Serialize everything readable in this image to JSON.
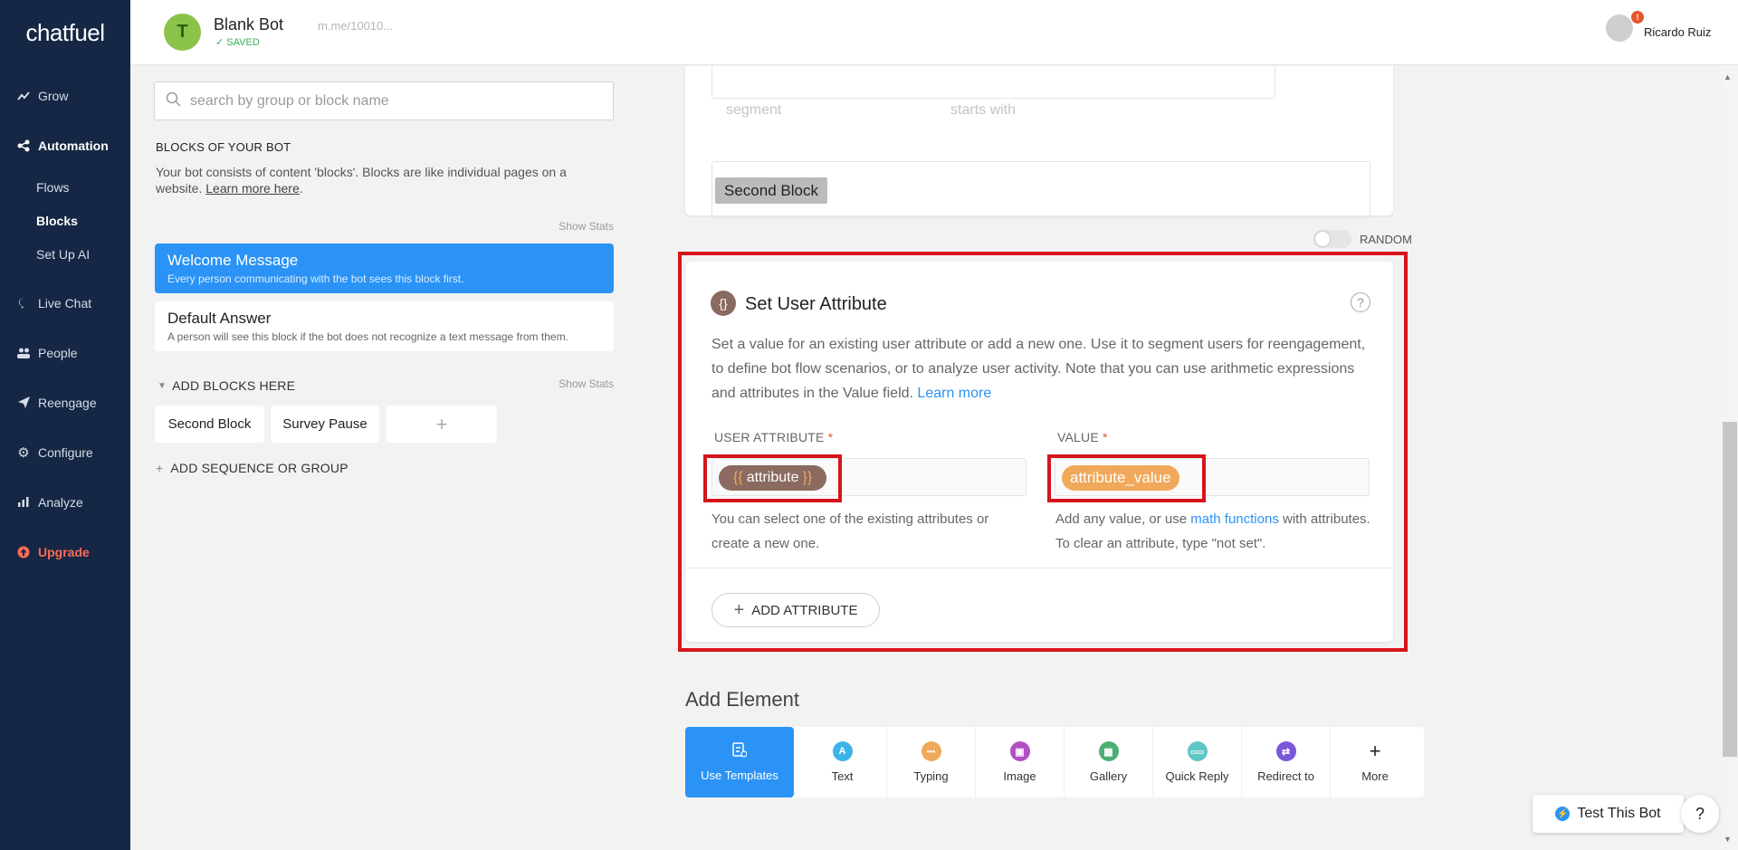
{
  "nav": {
    "logo": "chatfuel",
    "items": [
      {
        "label": "Grow",
        "icon": "trend-icon"
      },
      {
        "label": "Automation",
        "icon": "flow-icon"
      },
      {
        "label": "Live Chat",
        "icon": "chat-icon"
      },
      {
        "label": "People",
        "icon": "people-icon"
      },
      {
        "label": "Reengage",
        "icon": "send-icon"
      },
      {
        "label": "Configure",
        "icon": "gear-icon"
      },
      {
        "label": "Analyze",
        "icon": "bar-chart-icon"
      },
      {
        "label": "Upgrade",
        "icon": "upgrade-icon"
      }
    ],
    "sub_items": [
      "Flows",
      "Blocks",
      "Set Up AI"
    ]
  },
  "header": {
    "avatar_letter": "T",
    "bot_name": "Blank Bot",
    "saved_status": "SAVED",
    "bot_link": "m.me/10010...",
    "user_name": "Ricardo Ruiz",
    "notification_count": "!"
  },
  "blocks_panel": {
    "search_placeholder": "search by group or block name",
    "section_title": "BLOCKS OF YOUR BOT",
    "section_desc": "Your bot consists of content 'blocks'. Blocks are like individual pages on a website.",
    "learn_more": "Learn more here",
    "show_stats": "Show Stats",
    "blocks": [
      {
        "title": "Welcome Message",
        "desc": "Every person communicating with the bot sees this block first."
      },
      {
        "title": "Default Answer",
        "desc": "A person will see this block if the bot does not recognize a text message from them."
      }
    ],
    "add_blocks_title": "ADD BLOCKS HERE",
    "chips": [
      "Second Block",
      "Survey Pause"
    ],
    "add_chip": "+",
    "add_sequence": "ADD SEQUENCE OR GROUP"
  },
  "top_card": {
    "faded_segment": "segment",
    "faded_starts": "starts with",
    "goto_chip": "Second Block",
    "random_label": "RANDOM"
  },
  "attr_card": {
    "icon": "{}",
    "title": "Set User Attribute",
    "desc": "Set a value for an existing user attribute or add a new one. Use it to segment users for reengagement, to define bot flow scenarios, or to analyze user activity. Note that you can use arithmetic expressions and attributes in the Value field.",
    "learn_more": "Learn more",
    "user_attr_label": "USER ATTRIBUTE",
    "value_label": "VALUE",
    "required_mark": "*",
    "attr_pill": "attribute",
    "brace_open": "{{",
    "brace_close": "}}",
    "value_pill": "attribute_value",
    "attr_hint": "You can select one of the existing attributes or create a new one.",
    "value_hint_pre": "Add any value, or use",
    "value_hint_link": "math functions",
    "value_hint_post": "with attributes. To clear an attribute, type \"not set\".",
    "add_attr_btn": "ADD ATTRIBUTE"
  },
  "add_element": {
    "title": "Add Element",
    "items": [
      {
        "label": "Use Templates",
        "icon": "template-icon"
      },
      {
        "label": "Text",
        "icon": "text-icon",
        "glyph": "A",
        "color": "#3cb4e7"
      },
      {
        "label": "Typing",
        "icon": "typing-icon",
        "glyph": "•••",
        "color": "#f0a95a"
      },
      {
        "label": "Image",
        "icon": "image-icon",
        "glyph": "▣",
        "color": "#b14fc5"
      },
      {
        "label": "Gallery",
        "icon": "gallery-icon",
        "glyph": "▦",
        "color": "#4caf73"
      },
      {
        "label": "Quick Reply",
        "icon": "quick-reply-icon",
        "glyph": "▭▭",
        "color": "#5fc6c6"
      },
      {
        "label": "Redirect to",
        "icon": "redirect-icon",
        "glyph": "⇄",
        "color": "#7b57d9"
      },
      {
        "label": "More",
        "icon": "plus-icon",
        "glyph": "+",
        "color": "#222222"
      }
    ]
  },
  "footer": {
    "test_bot": "Test This Bot",
    "help": "?"
  }
}
